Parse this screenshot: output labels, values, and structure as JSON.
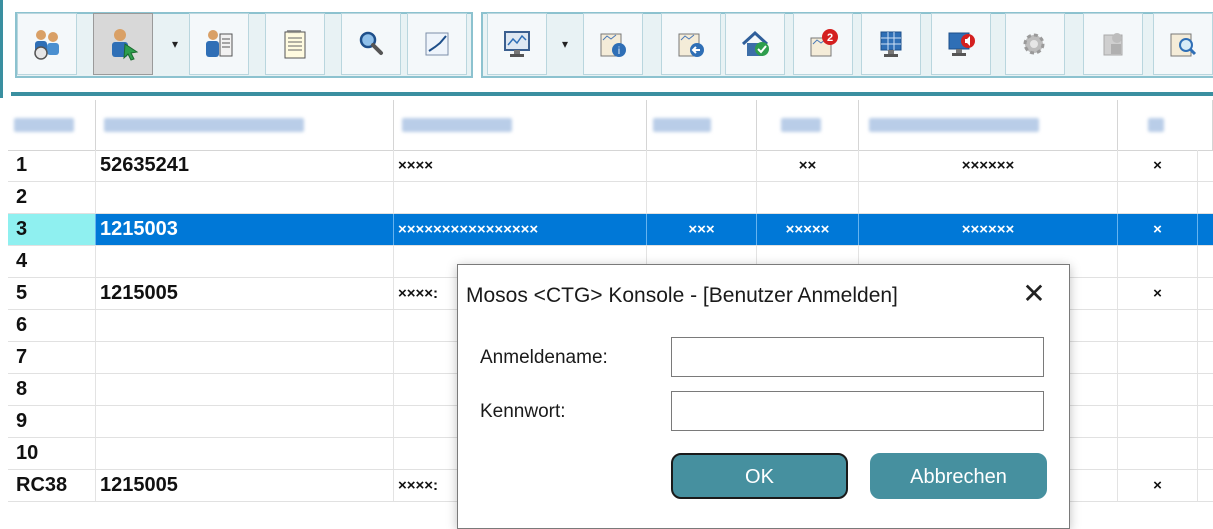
{
  "toolbar": {
    "buttons": [
      {
        "icon": "users-settings-icon"
      },
      {
        "icon": "user-select-icon"
      },
      {
        "icon": "user-document-icon"
      },
      {
        "icon": "notepad-icon"
      },
      {
        "icon": "search-icon"
      },
      {
        "icon": "line-chart-icon"
      },
      {
        "icon": "monitor-chart-icon"
      },
      {
        "icon": "info-document-icon"
      },
      {
        "icon": "back-document-icon"
      },
      {
        "icon": "home-check-icon"
      },
      {
        "icon": "alerts-icon",
        "badge": "2"
      },
      {
        "icon": "grid-monitor-icon"
      },
      {
        "icon": "monitor-sound-icon"
      },
      {
        "icon": "disabled-gear-icon"
      },
      {
        "icon": "disabled-lock-icon"
      },
      {
        "icon": "zoom-document-icon"
      }
    ]
  },
  "grid": {
    "rows": [
      {
        "id": "1",
        "c1": "52635241",
        "c2": "××××",
        "c3": "",
        "c4": "××",
        "c5": "××××××",
        "c6": "×",
        "selected": false
      },
      {
        "id": "2",
        "c1": "",
        "c2": "",
        "c3": "",
        "c4": "",
        "c5": "",
        "c6": "",
        "selected": false
      },
      {
        "id": "3",
        "c1": "1215003",
        "c2": "××××××××××××××××",
        "c3": "×××",
        "c4": "×××××",
        "c5": "××××××",
        "c6": "×",
        "selected": true
      },
      {
        "id": "4",
        "c1": "",
        "c2": "",
        "c3": "",
        "c4": "",
        "c5": "",
        "c6": "",
        "selected": false
      },
      {
        "id": "5",
        "c1": "1215005",
        "c2": "××××:",
        "c3": "",
        "c4": "",
        "c5": "",
        "c6": "×",
        "selected": false
      },
      {
        "id": "6",
        "c1": "",
        "c2": "",
        "c3": "",
        "c4": "",
        "c5": "",
        "c6": "",
        "selected": false
      },
      {
        "id": "7",
        "c1": "",
        "c2": "",
        "c3": "",
        "c4": "",
        "c5": "",
        "c6": "",
        "selected": false
      },
      {
        "id": "8",
        "c1": "",
        "c2": "",
        "c3": "",
        "c4": "",
        "c5": "",
        "c6": "",
        "selected": false
      },
      {
        "id": "9",
        "c1": "",
        "c2": "",
        "c3": "",
        "c4": "",
        "c5": "",
        "c6": "",
        "selected": false
      },
      {
        "id": "10",
        "c1": "",
        "c2": "",
        "c3": "",
        "c4": "",
        "c5": "",
        "c6": "",
        "selected": false
      },
      {
        "id": "RC38",
        "c1": "1215005",
        "c2": "××××:",
        "c3": "",
        "c4": "",
        "c5": "",
        "c6": "×",
        "selected": false
      }
    ]
  },
  "dialog": {
    "title": "Mosos <CTG> Konsole - [Benutzer Anmelden]",
    "close_label": "✕",
    "username_label": "Anmeldename:",
    "username_value": "",
    "password_label": "Kennwort:",
    "password_value": "",
    "ok_label": "OK",
    "cancel_label": "Abbrechen"
  },
  "colors": {
    "accent": "#3a8fa0",
    "selection": "#0078d7",
    "selection_id": "#8ff0f0",
    "button": "#46909f"
  }
}
